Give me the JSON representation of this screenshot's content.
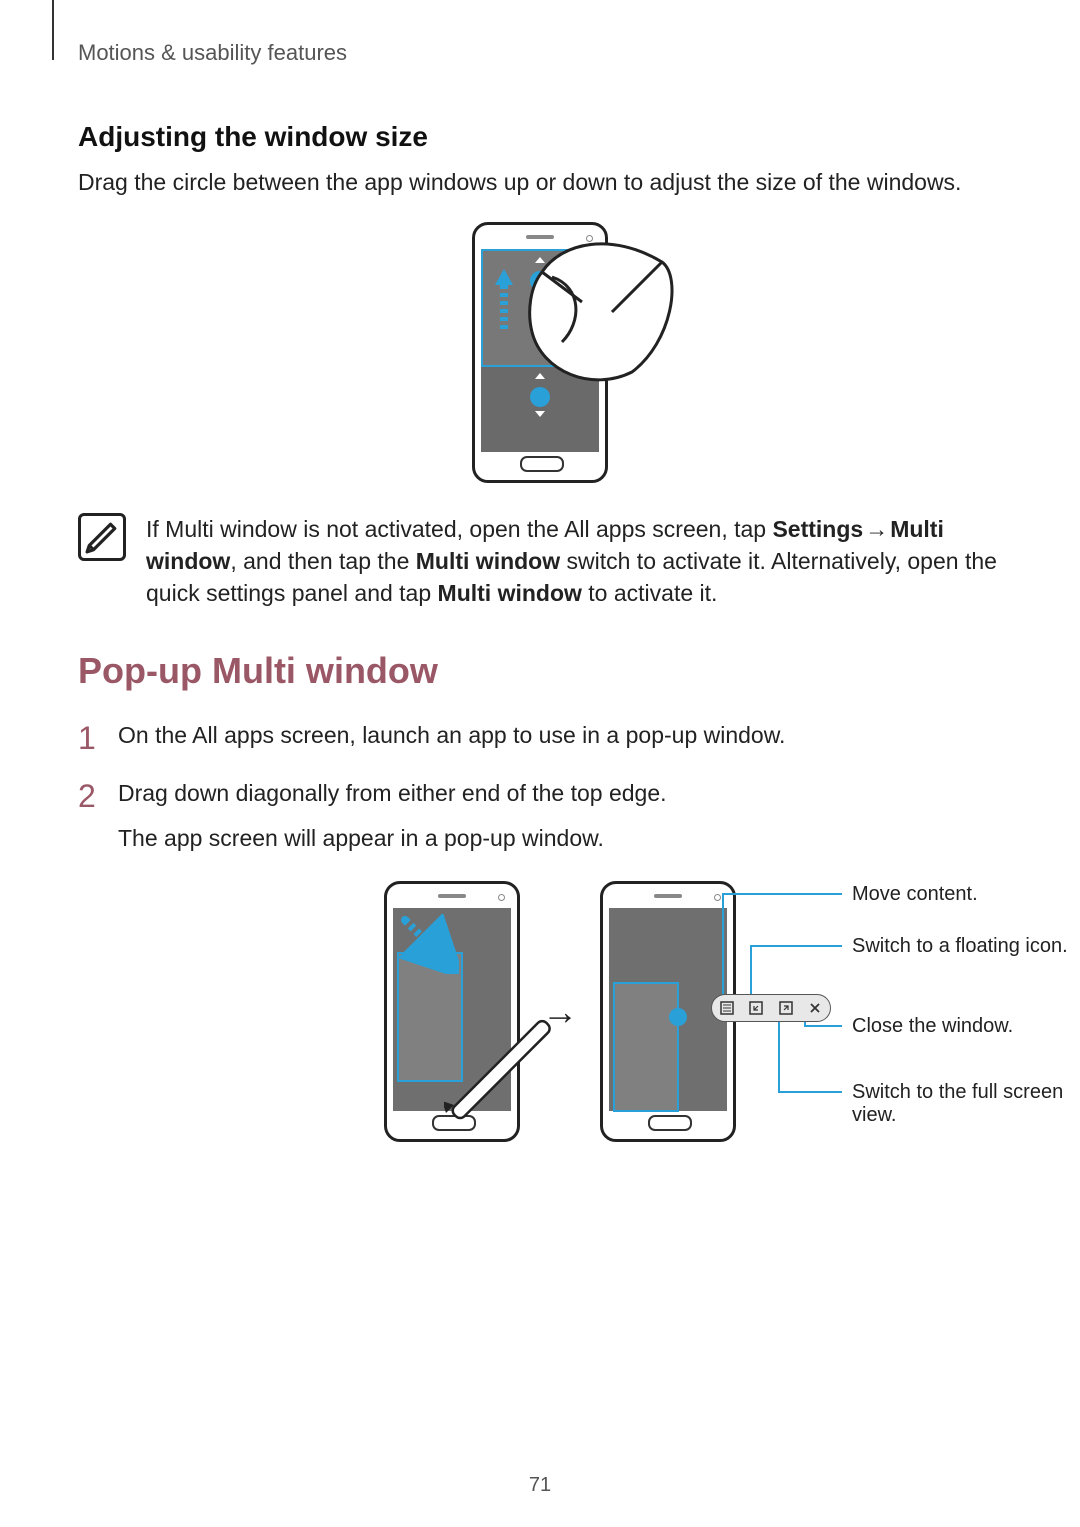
{
  "header": {
    "running_head": "Motions & usability features"
  },
  "section1": {
    "heading": "Adjusting the window size",
    "body": "Drag the circle between the app windows up or down to adjust the size of the windows."
  },
  "note": {
    "pre": "If Multi window is not activated, open the All apps screen, tap ",
    "b1": "Settings",
    "arrow": " → ",
    "b2": "Multi window",
    "mid": ", and then tap the ",
    "b3": "Multi window",
    "mid2": " switch to activate it. Alternatively, open the quick settings panel and tap ",
    "b4": "Multi window",
    "post": " to activate it."
  },
  "section2": {
    "heading": "Pop-up Multi window",
    "steps": [
      {
        "num": "1",
        "text": "On the All apps screen, launch an app to use in a pop-up window."
      },
      {
        "num": "2",
        "text": "Drag down diagonally from either end of the top edge.",
        "follow": "The app screen will appear in a pop-up window."
      }
    ]
  },
  "callouts": {
    "move": "Move content.",
    "float": "Switch to a floating icon.",
    "close": "Close the window.",
    "full": "Switch to the full screen view."
  },
  "page_number": "71"
}
